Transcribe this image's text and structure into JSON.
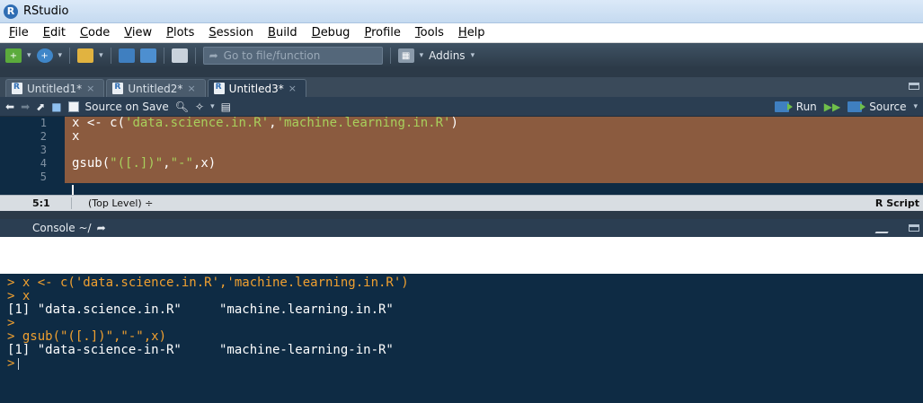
{
  "window": {
    "title": "RStudio",
    "logo_letter": "R"
  },
  "menu": [
    "File",
    "Edit",
    "Code",
    "View",
    "Plots",
    "Session",
    "Build",
    "Debug",
    "Profile",
    "Tools",
    "Help"
  ],
  "toolbar": {
    "goto_placeholder": "Go to file/function",
    "addins_label": "Addins"
  },
  "tabs": [
    {
      "label": "Untitled1*",
      "active": false
    },
    {
      "label": "Untitled2*",
      "active": false
    },
    {
      "label": "Untitled3*",
      "active": true
    }
  ],
  "editor_toolbar": {
    "source_on_save": "Source on Save",
    "run": "Run",
    "source": "Source"
  },
  "code": {
    "lines": [
      {
        "num": "1",
        "text": "x <- c(",
        "s1": "'data.science.in.R'",
        "mid": ",",
        "s2": "'machine.learning.in.R'",
        "end": ")"
      },
      {
        "num": "2",
        "text": "x"
      },
      {
        "num": "3",
        "text": ""
      },
      {
        "num": "4",
        "text": "gsub(",
        "s1": "\"([.])\"",
        "mid": ",",
        "s2": "\"-\"",
        "end": ",x)"
      },
      {
        "num": "5",
        "text": ""
      }
    ]
  },
  "status": {
    "position": "5:1",
    "level": "(Top Level) ÷",
    "file_type": "R Script"
  },
  "console": {
    "title": "Console ~/",
    "lines": [
      {
        "kind": "cmd",
        "text": "> x <- c('data.science.in.R','machine.learning.in.R')"
      },
      {
        "kind": "cmd",
        "text": "> x"
      },
      {
        "kind": "out",
        "text": "[1] \"data.science.in.R\"     \"machine.learning.in.R\""
      },
      {
        "kind": "cmd",
        "text": ">"
      },
      {
        "kind": "cmd",
        "text": "> gsub(\"([.])\",\"-\",x)"
      },
      {
        "kind": "out",
        "text": "[1] \"data-science-in-R\"     \"machine-learning-in-R\""
      },
      {
        "kind": "cmd",
        "text": ">"
      }
    ]
  },
  "colors": {
    "editor_bg": "#0e2b44",
    "selection": "#8b5b3f",
    "string": "#a8d05c",
    "prompt": "#f0a030"
  }
}
